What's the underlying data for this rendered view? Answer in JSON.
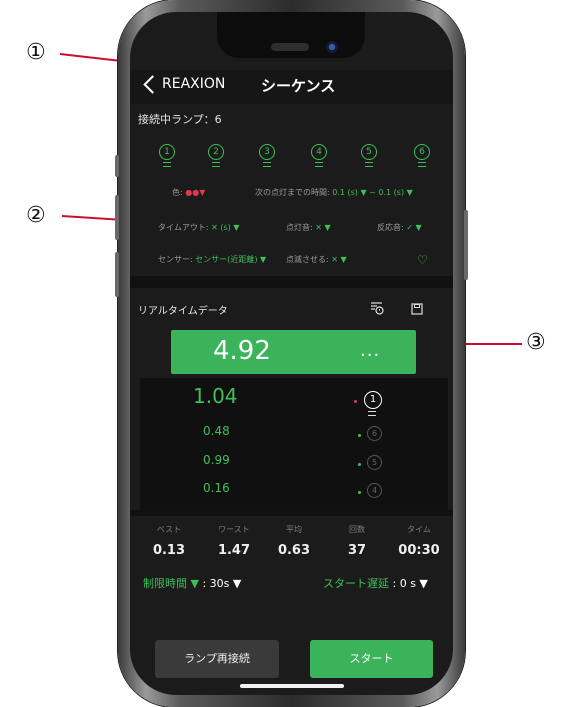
{
  "callouts": {
    "one": "①",
    "two": "②",
    "three": "③"
  },
  "nav": {
    "back_label": "REAXION",
    "title": "シーケンス"
  },
  "connected": {
    "label": "接続中ランプ：6",
    "lamps": [
      "1",
      "2",
      "3",
      "4",
      "5",
      "6"
    ]
  },
  "settings": {
    "color_label": "色:",
    "color_value": "●●▼",
    "next_light_label": "次の点灯までの時間:",
    "next_light_value": "0.1 (s) ▼ ~ 0.1 (s) ▼",
    "timeout_label": "タイムアウト:",
    "timeout_value": "✕ (s) ▼",
    "light_sound_label": "点灯音:",
    "light_sound_value": "✕ ▼",
    "response_sound_label": "反応音:",
    "response_sound_value": "✓ ▼",
    "sensor_label": "センサー:",
    "sensor_value": "センサー(近距離) ▼",
    "blink_label": "点滅させる:",
    "blink_value": "✕ ▼",
    "favorite_icon": "heart-icon"
  },
  "realtime": {
    "label": "リアルタイムデータ",
    "current_value": "4.92",
    "current_dots": "...",
    "history": [
      {
        "value": "1.04",
        "lamp": "1",
        "active": true
      },
      {
        "value": "0.48",
        "lamp": "6",
        "active": false
      },
      {
        "value": "0.99",
        "lamp": "5",
        "active": false
      },
      {
        "value": "0.16",
        "lamp": "4",
        "active": false
      }
    ]
  },
  "stats": {
    "headers": [
      "ベスト",
      "ワースト",
      "平均",
      "回数",
      "タイム"
    ],
    "values": [
      "0.13",
      "1.47",
      "0.63",
      "37",
      "00:30"
    ]
  },
  "limits": {
    "time_limit_label": "制限時間 ▼",
    "time_limit_value": ": 30s ▼",
    "start_delay_label": "スタート遅延",
    "start_delay_value": ": 0 s ▼"
  },
  "buttons": {
    "reconnect": "ランプ再接続",
    "start": "スタート"
  },
  "colors": {
    "accent": "#3bb35b",
    "background": "#1b1b1b",
    "leader": "#c8102e",
    "red_dot": "#e0394a"
  }
}
